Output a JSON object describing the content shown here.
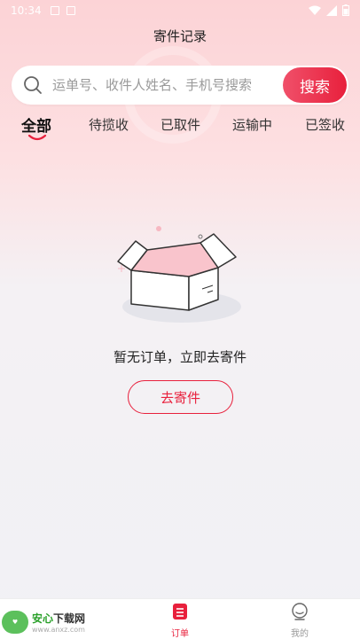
{
  "status_bar": {
    "time": "10:34"
  },
  "page": {
    "title": "寄件记录"
  },
  "search": {
    "placeholder": "运单号、收件人姓名、手机号搜索",
    "button_label": "搜索"
  },
  "tabs": [
    {
      "label": "全部",
      "active": true
    },
    {
      "label": "待揽收",
      "active": false
    },
    {
      "label": "已取件",
      "active": false
    },
    {
      "label": "运输中",
      "active": false
    },
    {
      "label": "已签收",
      "active": false
    }
  ],
  "empty_state": {
    "message": "暂无订单，立即去寄件",
    "button_label": "去寄件"
  },
  "bottom_nav": [
    {
      "label": "订单",
      "icon": "order-icon",
      "active": true
    },
    {
      "label": "我的",
      "icon": "profile-icon",
      "active": false
    }
  ],
  "watermark_logo": {
    "title_part1": "安心",
    "title_part2": "下载网",
    "url": "www.anxz.com"
  },
  "colors": {
    "accent": "#e8203c",
    "background_top": "#fcd3d6",
    "background_bottom": "#f1f1f5"
  }
}
